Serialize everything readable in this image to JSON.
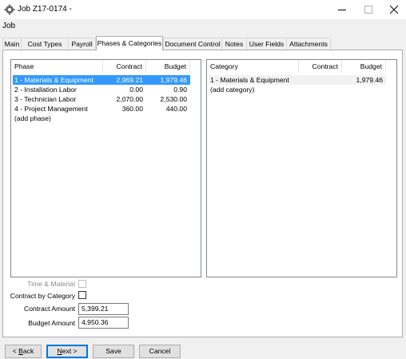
{
  "window": {
    "title": "Job Z17-0174 -",
    "subtitle": "Job"
  },
  "tabs": [
    {
      "label": "Main"
    },
    {
      "label": "Cost Types"
    },
    {
      "label": "Payroll"
    },
    {
      "label": "Phases & Categories",
      "active": true
    },
    {
      "label": "Document Control"
    },
    {
      "label": "Notes"
    },
    {
      "label": "User Fields"
    },
    {
      "label": "Attachments"
    }
  ],
  "phases": {
    "headers": {
      "phase": "Phase",
      "contract": "Contract",
      "budget": "Budget"
    },
    "rows": [
      {
        "phase": "1 - Materials & Equipment",
        "contract": "2,969.21",
        "budget": "1,979.46",
        "selected": true
      },
      {
        "phase": "2 - Installation Labor",
        "contract": "0.00",
        "budget": "0.90"
      },
      {
        "phase": "3 - Technician Labor",
        "contract": "2,070.00",
        "budget": "2,530.00"
      },
      {
        "phase": "4 - Project Management",
        "contract": "360.00",
        "budget": "440.00"
      },
      {
        "phase": "(add phase)",
        "contract": "",
        "budget": ""
      }
    ]
  },
  "categories": {
    "headers": {
      "category": "Category",
      "contract": "Contract",
      "budget": "Budget"
    },
    "rows": [
      {
        "category": "1 - Materials & Equipment",
        "contract": "",
        "budget": "1,979.46"
      },
      {
        "category": "(add category)",
        "contract": "",
        "budget": ""
      }
    ]
  },
  "form": {
    "time_material_label": "Time & Material",
    "time_material_checked": false,
    "contract_by_category_label": "Contract by Category",
    "contract_by_category_checked": false,
    "contract_amount_label": "Contract Amount",
    "contract_amount_value": "5,399.21",
    "budget_amount_label": "Budget Amount",
    "budget_amount_value": "4,950.36"
  },
  "buttons": {
    "back": {
      "pre": "< ",
      "key": "B",
      "post": "ack"
    },
    "next": {
      "key": "N",
      "post": "ext >"
    },
    "save": "Save",
    "cancel": "Cancel"
  }
}
